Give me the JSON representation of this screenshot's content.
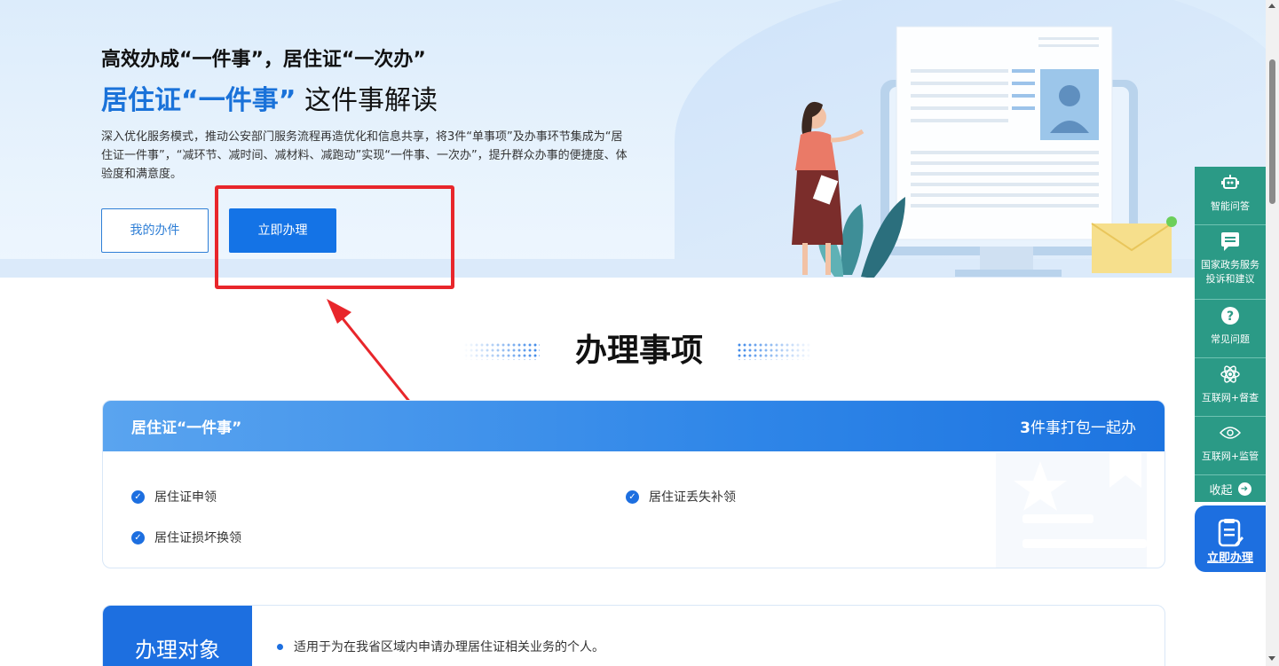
{
  "hero": {
    "subtitle": "高效办成“一件事”，居住证“一次办”",
    "title_highlight": "居住证“一件事”",
    "title_rest": " 这件事解读",
    "description": "深入优化服务模式，推动公安部门服务流程再造优化和信息共享，将3件“单事项”及办事环节集成为“居住证一件事”，“减环节、减时间、减材料、减跑动”实现“一件事、一次办”，提升群众办事的便捷度、体验度和满意度。",
    "my_button": "我的办件",
    "go_button": "立即办理"
  },
  "section": {
    "title": "办理事项"
  },
  "card": {
    "title": "居住证“一件事”",
    "count_number": "3",
    "count_text": "件事打包一起办",
    "items": [
      "居住证申领",
      "居住证丢失补领",
      "居住证损坏换领"
    ]
  },
  "target": {
    "label": "办理对象",
    "text": "适用于为在我省区域内申请办理居住证相关业务的个人。"
  },
  "float": {
    "ai": "智能问答",
    "complaint_1": "国家政务服务",
    "complaint_2": "投诉和建议",
    "faq": "常见问题",
    "supervise": "互联网+督查",
    "monitor": "互联网+监管",
    "collapse": "收起",
    "go": "立即办理"
  },
  "colors": {
    "primary": "#1473e6",
    "float_green": "#2b9a86",
    "annotation_red": "#e8262b"
  },
  "icons": [
    "robot-icon",
    "message-icon",
    "question-icon",
    "atom-icon",
    "eye-icon",
    "arrow-right-icon",
    "document-edit-icon",
    "check-icon"
  ]
}
